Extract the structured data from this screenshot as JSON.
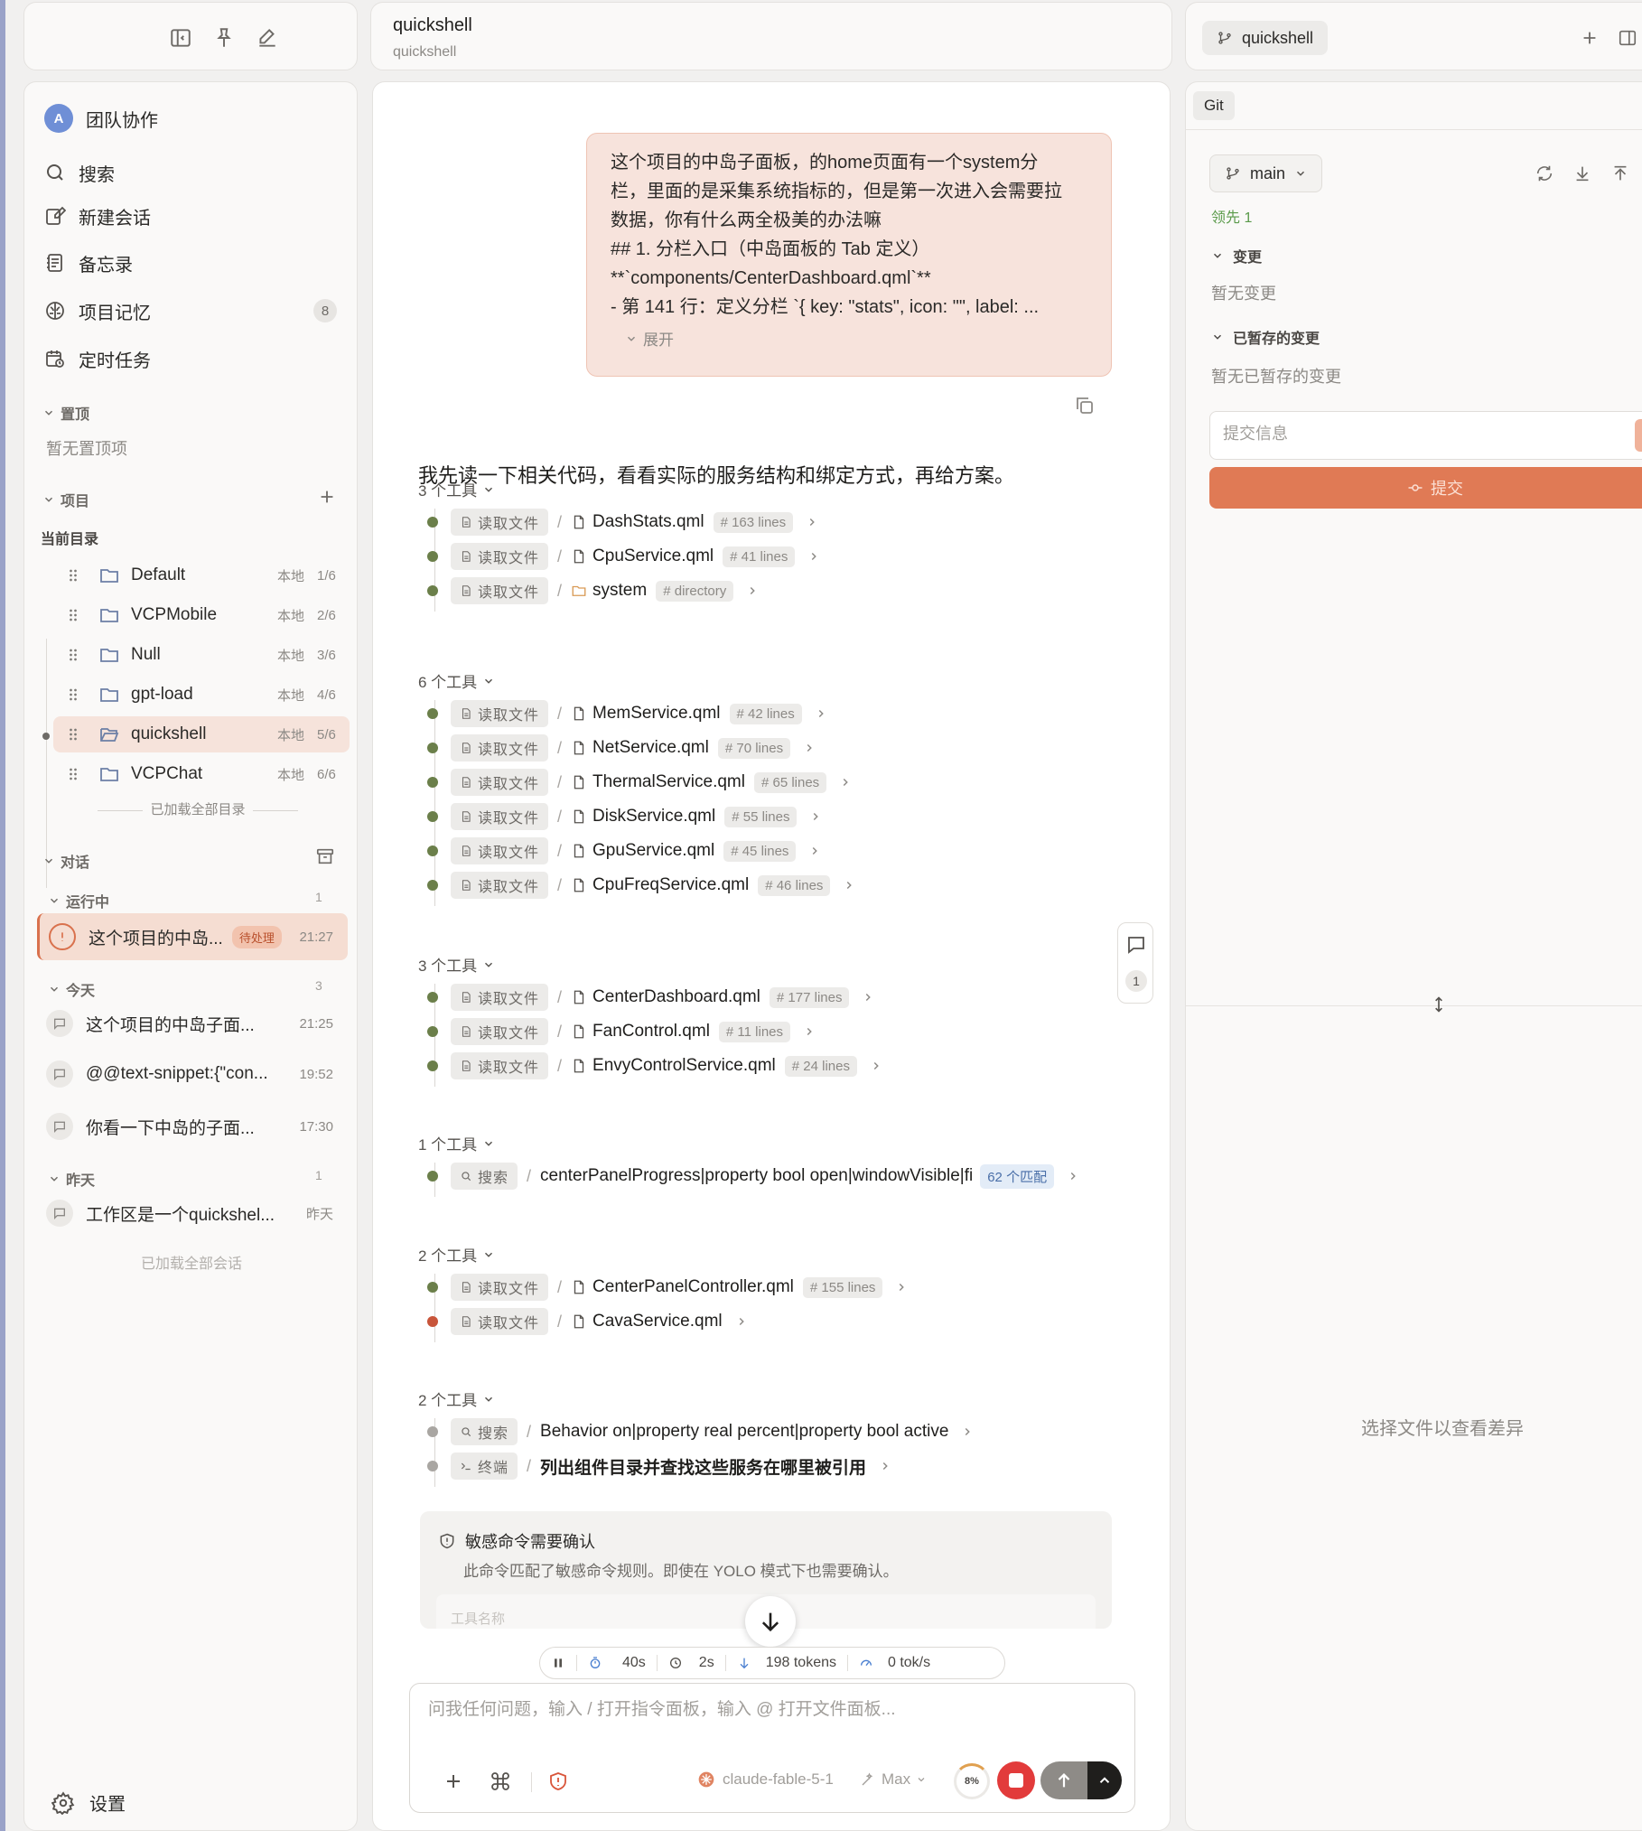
{
  "sidebar": {
    "workspace": {
      "avatar": "A",
      "name": "团队协作"
    },
    "nav": [
      {
        "label": "搜索",
        "icon": "search-icon"
      },
      {
        "label": "新建会话",
        "icon": "edit-icon"
      },
      {
        "label": "备忘录",
        "icon": "notes-icon"
      },
      {
        "label": "项目记忆",
        "icon": "brain-icon",
        "badge": "8"
      },
      {
        "label": "定时任务",
        "icon": "calendar-clock-icon"
      }
    ],
    "pinned": {
      "title": "置顶",
      "empty": "暂无置顶项"
    },
    "projects": {
      "title": "项目",
      "current_label": "当前目录",
      "items": [
        {
          "name": "Default",
          "location": "本地",
          "index": "1/6"
        },
        {
          "name": "VCPMobile",
          "location": "本地",
          "index": "2/6"
        },
        {
          "name": "Null",
          "location": "本地",
          "index": "3/6"
        },
        {
          "name": "gpt-load",
          "location": "本地",
          "index": "4/6"
        },
        {
          "name": "quickshell",
          "location": "本地",
          "index": "5/6"
        },
        {
          "name": "VCPChat",
          "location": "本地",
          "index": "6/6"
        }
      ],
      "loaded_all": "已加载全部目录"
    },
    "conversations": {
      "title": "对话",
      "running": {
        "label": "运行中",
        "count": "1",
        "items": [
          {
            "title": "这个项目的中岛...",
            "badge": "待处理",
            "time": "21:27"
          }
        ]
      },
      "today": {
        "label": "今天",
        "count": "3",
        "items": [
          {
            "title": "这个项目的中岛子面...",
            "time": "21:25"
          },
          {
            "title": "@@text-snippet:{\"con...",
            "time": "19:52"
          },
          {
            "title": "你看一下中岛的子面...",
            "time": "17:30"
          }
        ]
      },
      "yesterday": {
        "label": "昨天",
        "count": "1",
        "items": [
          {
            "title": "工作区是一个quickshel...",
            "time": "昨天"
          }
        ]
      },
      "loaded_all": "已加载全部会话"
    },
    "settings_label": "设置"
  },
  "center": {
    "title": "quickshell",
    "subtitle": "quickshell",
    "user_message": {
      "lines": [
        "这个项目的中岛子面板，的home页面有一个system分",
        "栏，里面的是采集系统指标的，但是第一次进入会需要拉",
        "数据，你有什么两全极美的办法嘛",
        "## 1. 分栏入口（中岛面板的 Tab 定义）",
        "**`components/CenterDashboard.qml`**",
        "- 第 141 行：定义分栏 `{ key: \"stats\", icon: \"\", label: ..."
      ],
      "expand_label": "展开"
    },
    "assistant_text": "我先读一下相关代码，看看实际的服务结构和绑定方式，再给方案。",
    "tool_groups": [
      {
        "header": "3 个工具",
        "tools": [
          {
            "tag": "读取文件",
            "file": "DashStats.qml",
            "lines": "# 163 lines",
            "status": "ok"
          },
          {
            "tag": "读取文件",
            "file": "CpuService.qml",
            "lines": "# 41 lines",
            "status": "ok"
          },
          {
            "tag": "读取文件",
            "file": "system",
            "lines": "# directory",
            "status": "ok",
            "dir": true
          }
        ]
      },
      {
        "header": "6 个工具",
        "tools": [
          {
            "tag": "读取文件",
            "file": "MemService.qml",
            "lines": "# 42 lines",
            "status": "ok"
          },
          {
            "tag": "读取文件",
            "file": "NetService.qml",
            "lines": "# 70 lines",
            "status": "ok"
          },
          {
            "tag": "读取文件",
            "file": "ThermalService.qml",
            "lines": "# 65 lines",
            "status": "ok"
          },
          {
            "tag": "读取文件",
            "file": "DiskService.qml",
            "lines": "# 55 lines",
            "status": "ok"
          },
          {
            "tag": "读取文件",
            "file": "GpuService.qml",
            "lines": "# 45 lines",
            "status": "ok"
          },
          {
            "tag": "读取文件",
            "file": "CpuFreqService.qml",
            "lines": "# 46 lines",
            "status": "ok"
          }
        ]
      },
      {
        "header": "3 个工具",
        "tools": [
          {
            "tag": "读取文件",
            "file": "CenterDashboard.qml",
            "lines": "# 177 lines",
            "status": "ok"
          },
          {
            "tag": "读取文件",
            "file": "FanControl.qml",
            "lines": "# 11 lines",
            "status": "ok"
          },
          {
            "tag": "读取文件",
            "file": "EnvyControlService.qml",
            "lines": "# 24 lines",
            "status": "ok"
          }
        ]
      },
      {
        "header": "1 个工具",
        "tools": [
          {
            "tag": "搜索",
            "query": "centerPanelProgress|property bool open|windowVisible|fi",
            "match": "62 个匹配",
            "status": "ok"
          }
        ]
      },
      {
        "header": "2 个工具",
        "tools": [
          {
            "tag": "读取文件",
            "file": "CenterPanelController.qml",
            "lines": "# 155 lines",
            "status": "ok"
          },
          {
            "tag": "读取文件",
            "file": "CavaService.qml",
            "status": "error"
          }
        ]
      },
      {
        "header": "2 个工具",
        "tools": [
          {
            "tag": "搜索",
            "query": "Behavior on|property real percent|property bool active",
            "status": "pending"
          },
          {
            "tag": "终端",
            "query": "列出组件目录并查找这些服务在哪里被引用",
            "status": "pending",
            "bold": true
          }
        ]
      }
    ],
    "confirm": {
      "title": "敏感命令需要确认",
      "desc": "此命令匹配了敏感命令规则。即使在 YOLO 模式下也需要确认。",
      "inner": "工具名称"
    },
    "side_comment_count": "1",
    "stats": {
      "elapsed": "40s",
      "latency": "2s",
      "tokens": "198 tokens",
      "speed": "0 tok/s"
    },
    "composer": {
      "placeholder": "问我任何问题，输入 / 打开指令面板，输入 @ 打开文件面板...",
      "model": "claude-fable-5-1",
      "effort": "Max",
      "context": "8%"
    }
  },
  "right": {
    "branch_chip": "quickshell",
    "tab": "Git",
    "branch": "main",
    "ahead": "领先 1",
    "changes": {
      "title": "变更",
      "empty": "暂无变更"
    },
    "staged": {
      "title": "已暂存的变更",
      "empty": "暂无已暂存的变更"
    },
    "commit_placeholder": "提交信息",
    "commit_label": "提交",
    "diff_empty": "选择文件以查看差异"
  },
  "colors": {
    "accent": "#e07a55",
    "running_bg": "#f5ddd2",
    "ok_dot": "#6b7f4a",
    "error_dot": "#c8553a"
  }
}
